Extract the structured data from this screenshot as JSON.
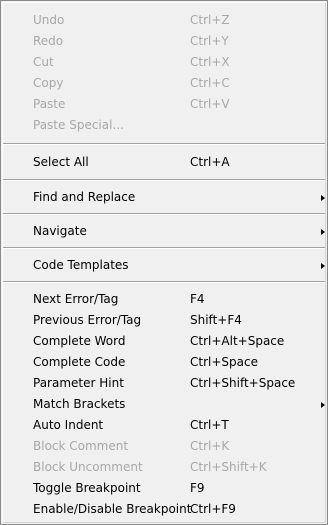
{
  "menu": {
    "items": [
      {
        "label": "Undo",
        "shortcut": "Ctrl+Z"
      },
      {
        "label": "Redo",
        "shortcut": "Ctrl+Y"
      },
      {
        "label": "Cut",
        "shortcut": "Ctrl+X"
      },
      {
        "label": "Copy",
        "shortcut": "Ctrl+C"
      },
      {
        "label": "Paste",
        "shortcut": "Ctrl+V"
      },
      {
        "label": "Paste Special...",
        "shortcut": ""
      },
      {
        "label": "Select All",
        "shortcut": "Ctrl+A"
      },
      {
        "label": "Find and Replace",
        "shortcut": ""
      },
      {
        "label": "Navigate",
        "shortcut": ""
      },
      {
        "label": "Code Templates",
        "shortcut": ""
      },
      {
        "label": "Next Error/Tag",
        "shortcut": "F4"
      },
      {
        "label": "Previous Error/Tag",
        "shortcut": "Shift+F4"
      },
      {
        "label": "Complete Word",
        "shortcut": "Ctrl+Alt+Space"
      },
      {
        "label": "Complete Code",
        "shortcut": "Ctrl+Space"
      },
      {
        "label": "Parameter Hint",
        "shortcut": "Ctrl+Shift+Space"
      },
      {
        "label": "Match Brackets",
        "shortcut": ""
      },
      {
        "label": "Auto Indent",
        "shortcut": "Ctrl+T"
      },
      {
        "label": "Block Comment",
        "shortcut": "Ctrl+K"
      },
      {
        "label": "Block Uncomment",
        "shortcut": "Ctrl+Shift+K"
      },
      {
        "label": "Toggle Breakpoint",
        "shortcut": "F9"
      },
      {
        "label": "Enable/Disable Breakpoint",
        "shortcut": "Ctrl+F9"
      }
    ]
  },
  "colors": {
    "menu_background": "#f0f0f0",
    "disabled_text": "#a8a8a8",
    "enabled_text": "#000000",
    "separator": "#a0a0a0"
  },
  "icons": {
    "submenu_arrow": "submenu-arrow-icon"
  }
}
